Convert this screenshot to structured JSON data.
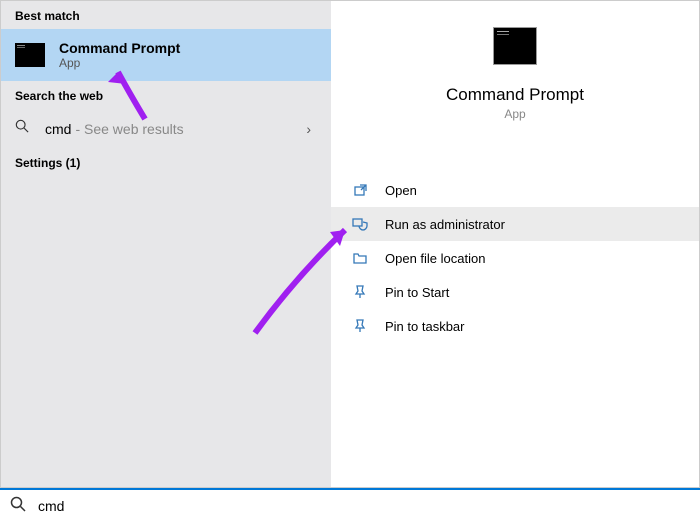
{
  "left": {
    "bestMatchHeader": "Best match",
    "bestMatch": {
      "title": "Command Prompt",
      "subtitle": "App"
    },
    "searchWebHeader": "Search the web",
    "webQuery": "cmd",
    "webHint": "- See web results",
    "settingsHeader": "Settings (1)"
  },
  "preview": {
    "title": "Command Prompt",
    "subtitle": "App"
  },
  "actions": {
    "open": "Open",
    "runAdmin": "Run as administrator",
    "openLocation": "Open file location",
    "pinStart": "Pin to Start",
    "pinTaskbar": "Pin to taskbar"
  },
  "search": {
    "value": "cmd"
  }
}
